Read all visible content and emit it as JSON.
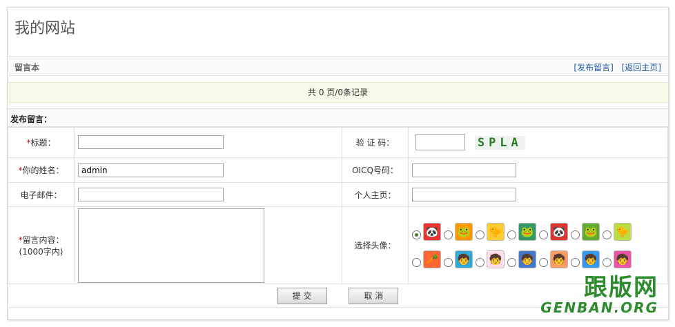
{
  "site_title": "我的网站",
  "section_title": "留言本",
  "links": {
    "post": "[发布留言]",
    "home": "[返回主页]"
  },
  "pagination": "共 0 页/0条记录",
  "form_header": "发布留言：",
  "fields": {
    "title_label": "标题：",
    "name_label": "你的姓名：",
    "name_value": "admin",
    "email_label": "电子邮件：",
    "content_label": "留言内容：",
    "content_hint": "(1000字内)",
    "captcha_label": "验 证 码：",
    "captcha_text": "SPLA",
    "qq_label": "OICQ号码：",
    "homepage_label": "个人主页：",
    "avatar_label": "选择头像：",
    "required_mark": "*"
  },
  "avatars": {
    "row1": [
      "🐼",
      "🐸",
      "🐤",
      "🐸",
      "🐼",
      "🐸",
      "🐤"
    ],
    "row2": [
      "🥕",
      "🧒",
      "🧒",
      "🧒",
      "🧒",
      "🧒",
      "🧒"
    ],
    "selected": 0
  },
  "buttons": {
    "submit": "提 交",
    "cancel": "取 消"
  },
  "watermark": {
    "cn": "跟版网",
    "en": "GENBAN.ORG"
  }
}
